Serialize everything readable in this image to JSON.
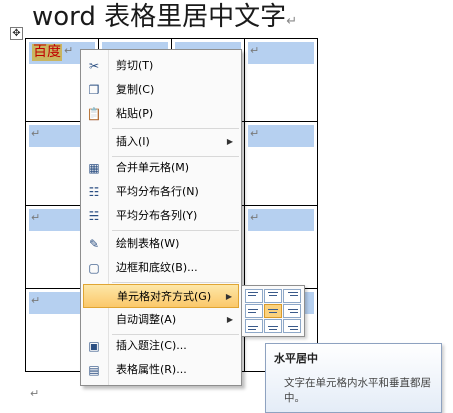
{
  "heading": "word 表格里居中文字",
  "paragraph_mark": "↵",
  "move_handle": "✥",
  "table": {
    "cell_text": "百度",
    "cell_mark": "↵"
  },
  "menu": [
    {
      "label": "剪切(T)",
      "icon": "scissors-icon",
      "glyph": "✂"
    },
    {
      "label": "复制(C)",
      "icon": "copy-icon",
      "glyph": "❐"
    },
    {
      "label": "粘贴(P)",
      "icon": "paste-icon",
      "glyph": "📋"
    },
    {
      "label": "插入(I)",
      "icon": "insert-icon",
      "glyph": "",
      "submenu": true
    },
    {
      "label": "合并单元格(M)",
      "icon": "merge-cells-icon",
      "glyph": "▦"
    },
    {
      "label": "平均分布各行(N)",
      "icon": "distribute-rows-icon",
      "glyph": "☷"
    },
    {
      "label": "平均分布各列(Y)",
      "icon": "distribute-columns-icon",
      "glyph": "☵"
    },
    {
      "label": "绘制表格(W)",
      "icon": "draw-table-icon",
      "glyph": "✎"
    },
    {
      "label": "边框和底纹(B)...",
      "icon": "borders-shading-icon",
      "glyph": "▢"
    },
    {
      "label": "单元格对齐方式(G)",
      "icon": "",
      "glyph": "",
      "submenu": true,
      "active": true
    },
    {
      "label": "自动调整(A)",
      "icon": "",
      "glyph": "",
      "submenu": true
    },
    {
      "label": "插入题注(C)...",
      "icon": "caption-icon",
      "glyph": "▣"
    },
    {
      "label": "表格属性(R)...",
      "icon": "table-properties-icon",
      "glyph": "▤"
    }
  ],
  "tooltip": {
    "title": "水平居中",
    "body": "文字在单元格内水平和垂直都居中。"
  },
  "colors": {
    "cell_highlight": "#b6d0f0",
    "menu_active": "#fbc86a",
    "cell_text": "#c00000"
  }
}
